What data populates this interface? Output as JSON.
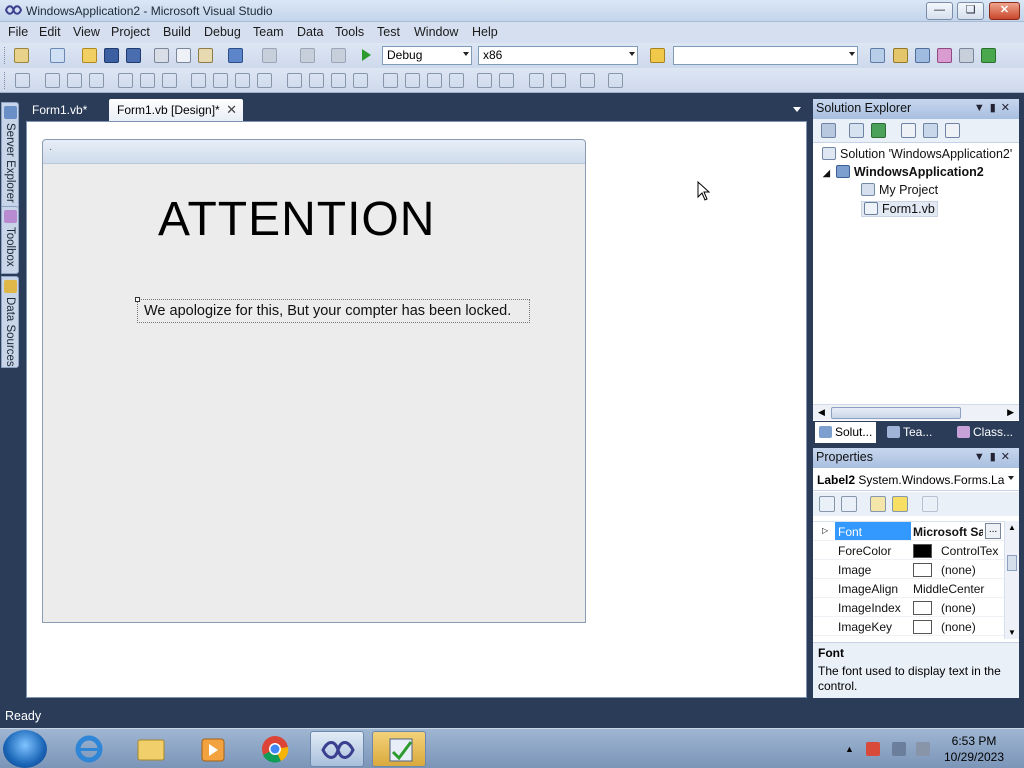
{
  "window": {
    "title": "WindowsApplication2 - Microsoft Visual Studio"
  },
  "menu": [
    "File",
    "Edit",
    "View",
    "Project",
    "Build",
    "Debug",
    "Team",
    "Data",
    "Tools",
    "Test",
    "Window",
    "Help"
  ],
  "toolbar": {
    "config": "Debug",
    "platform": "x86",
    "find": ""
  },
  "left_tabs": [
    "Server Explorer",
    "Toolbox",
    "Data Sources"
  ],
  "doc_tabs": [
    {
      "label": "Form1.vb*"
    },
    {
      "label": "Form1.vb [Design]*"
    }
  ],
  "form": {
    "caption": "",
    "attention_text": "ATTENTION",
    "label2_text": "We apologize for this, But your compter has been locked."
  },
  "solution_explorer": {
    "title": "Solution Explorer",
    "tree": {
      "solution": "Solution 'WindowsApplication2'",
      "project": "WindowsApplication2",
      "items": [
        "My Project",
        "Form1.vb"
      ]
    },
    "tabs": [
      "Solut...",
      "Tea...",
      "Class..."
    ]
  },
  "properties": {
    "title": "Properties",
    "object": "Label2",
    "object_type": "System.Windows.Forms.La",
    "rows": [
      {
        "name": "Font",
        "value": "Microsoft Sa"
      },
      {
        "name": "ForeColor",
        "value": "ControlTex"
      },
      {
        "name": "Image",
        "value": "(none)"
      },
      {
        "name": "ImageAlign",
        "value": "MiddleCenter"
      },
      {
        "name": "ImageIndex",
        "value": "(none)"
      },
      {
        "name": "ImageKey",
        "value": "(none)"
      }
    ],
    "desc_title": "Font",
    "desc_text": "The font used to display text in the control."
  },
  "status": "Ready",
  "clock": {
    "time": "6:53 PM",
    "date": "10/29/2023"
  },
  "colors": {
    "accent": "#2b3c59",
    "selection": "#3399ff"
  }
}
